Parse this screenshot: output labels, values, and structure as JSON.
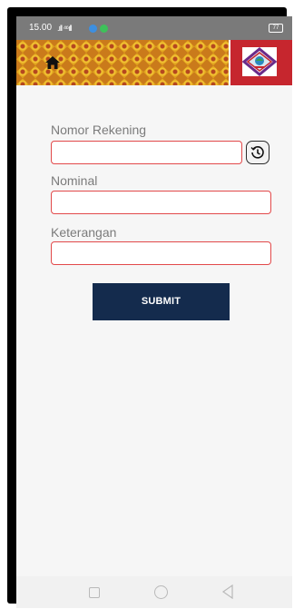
{
  "status_bar": {
    "time": "15.00",
    "signal": ".ıll ⁴⁶ıll",
    "battery": "77"
  },
  "header": {
    "home_icon": "home-icon",
    "logo_icon": "bank-logo-icon"
  },
  "form": {
    "account_number_label": "Nomor Rekening",
    "account_number_value": "",
    "history_icon": "history-icon",
    "amount_label": "Nominal",
    "amount_value": "",
    "description_label": "Keterangan",
    "description_value": "",
    "submit_label": "SUBMIT"
  },
  "colors": {
    "header_gold": "#e0a21e",
    "logo_red": "#c6262e",
    "input_border": "#e2494a",
    "submit_bg": "#142b4d",
    "label_gray": "#7b7b7b"
  }
}
